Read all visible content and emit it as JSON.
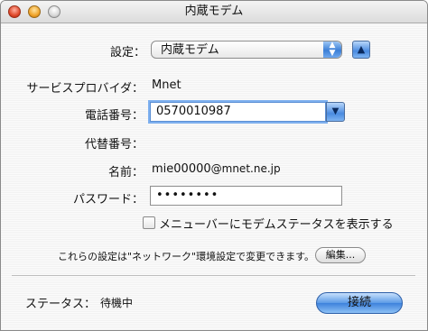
{
  "window": {
    "title": "内蔵モデム"
  },
  "settings": {
    "label": "設定：",
    "selected": "内蔵モデム"
  },
  "provider": {
    "label": "サービスプロバイダ：",
    "value": "Mnet"
  },
  "phone": {
    "label": "電話番号：",
    "value": "0570010987"
  },
  "alt_phone": {
    "label": "代替番号："
  },
  "account": {
    "label": "名前：",
    "value_prefix": "mie00000",
    "value_domain": "@mnet.ne.jp"
  },
  "password": {
    "label": "パスワード：",
    "masked": "••••••••"
  },
  "status_menu": {
    "label": "メニューバーにモデムステータスを表示する",
    "checked": false
  },
  "note": {
    "text": "これらの設定は\"ネットワーク\"環境設定で変更できます。",
    "edit_button": "編集..."
  },
  "status": {
    "label": "ステータス：",
    "value": "待機中",
    "connect_button": "接続"
  }
}
